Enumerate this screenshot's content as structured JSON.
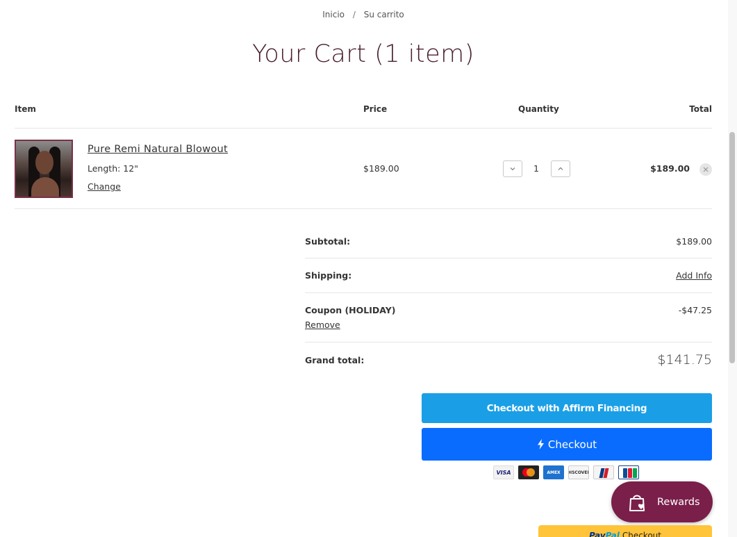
{
  "breadcrumb": {
    "home": "Inicio",
    "separator": "/",
    "current": "Su carrito"
  },
  "page_title": "Your Cart (1 item)",
  "table_headers": {
    "item": "Item",
    "price": "Price",
    "quantity": "Quantity",
    "total": "Total"
  },
  "cart_items": [
    {
      "title": "Pure Remi Natural Blowout",
      "variant": "Length: 12\"",
      "change_label": "Change",
      "price": "$189.00",
      "quantity": "1",
      "total": "$189.00"
    }
  ],
  "summary": {
    "subtotal_label": "Subtotal:",
    "subtotal_value": "$189.00",
    "shipping_label": "Shipping:",
    "shipping_value": "Add Info",
    "coupon_label": "Coupon (HOLIDAY)",
    "coupon_remove": "Remove",
    "coupon_value": "-$47.25",
    "grand_label": "Grand total:",
    "grand_value": "$141.75"
  },
  "buttons": {
    "affirm": "Checkout with Affirm Financing",
    "checkout": "Checkout",
    "rewards": "Rewards",
    "paypal_brand_1": "Pay",
    "paypal_brand_2": "Pal",
    "paypal_suffix": "Checkout"
  },
  "payment_cards": {
    "visa": "VISA",
    "amex": "AMEX",
    "discover": "DISCOVER"
  },
  "icons": [
    "chevron-down-icon",
    "chevron-up-icon",
    "close-icon",
    "bolt-icon",
    "shopping-bag-heart-icon",
    "mastercard-icon",
    "diners-icon",
    "jcb-icon"
  ],
  "colors": {
    "title": "#4a1f32",
    "affirm": "#1a9fe6",
    "checkout": "#0a6cff",
    "rewards": "#7a1f4a",
    "paypal": "#ffc439"
  }
}
